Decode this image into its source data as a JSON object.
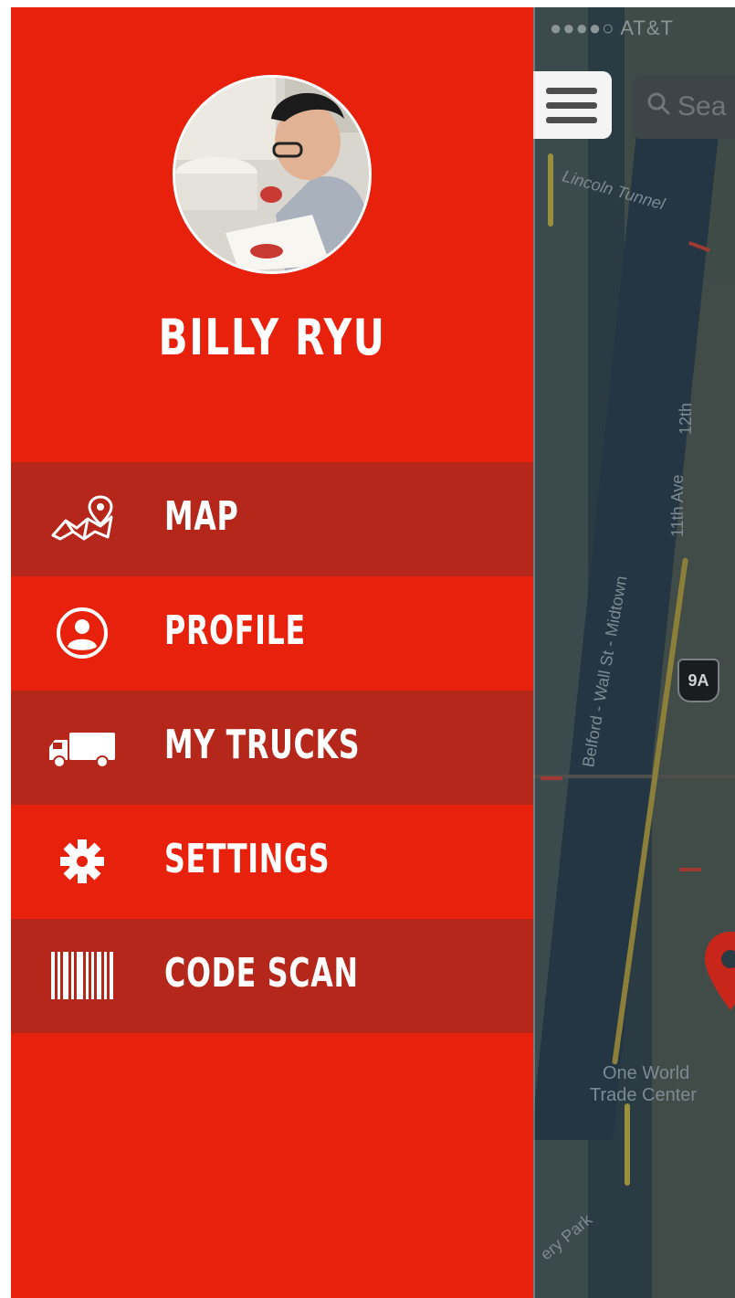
{
  "status_bar": {
    "carrier": "●●●●○ AT&T"
  },
  "map": {
    "search_placeholder": "Sea",
    "labels": {
      "lincoln_tunnel": "Lincoln Tunnel",
      "twelfth_ave": "12th",
      "eleventh_ave": "11th Ave",
      "belford": "Belford - Wall St - Midtown",
      "route_shield": "9A",
      "one_world": "One World",
      "trade_center": "Trade Center",
      "park": "ery Park"
    }
  },
  "profile": {
    "name": "BILLY RYU"
  },
  "menu": {
    "items": [
      {
        "label": "MAP",
        "icon": "map-pin-icon",
        "style": "dark"
      },
      {
        "label": "PROFILE",
        "icon": "user-circle-icon",
        "style": "light"
      },
      {
        "label": "MY TRUCKS",
        "icon": "truck-icon",
        "style": "dark"
      },
      {
        "label": "SETTINGS",
        "icon": "gear-icon",
        "style": "light"
      },
      {
        "label": "CODE SCAN",
        "icon": "barcode-icon",
        "style": "dark"
      }
    ]
  },
  "colors": {
    "drawer_red": "#e7210c",
    "menu_dark_red": "#b6271b",
    "map_dark": "#2a3b44",
    "text": "#ffffff"
  }
}
